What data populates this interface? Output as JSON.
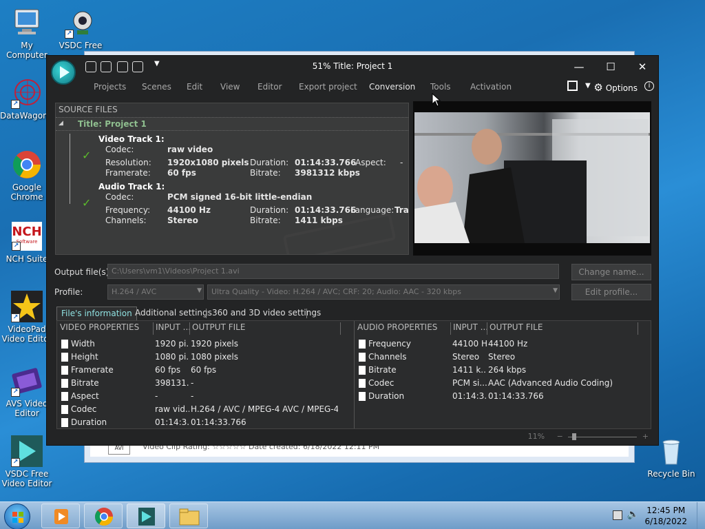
{
  "desktop": {
    "icons": [
      {
        "label": "My Computer"
      },
      {
        "label": "VSDC Free Video..."
      },
      {
        "label": "DataWagon..."
      },
      {
        "label": "Google Chrome"
      },
      {
        "label": "NCH Suite"
      },
      {
        "label": "VideoPad Video Editor"
      },
      {
        "label": "AVS Video Editor"
      },
      {
        "label": "VSDC Free Video Editor"
      },
      {
        "label": "Recycle Bin"
      }
    ],
    "nch_logo": "NCH",
    "nch_logo_sub": "Software"
  },
  "bg_window": {
    "file_type": "AVI",
    "strip_text": "Video Clip  Rating: ☆☆☆☆☆          Date created: 6/18/2022 12:11 PM"
  },
  "app": {
    "title": "51% Title: Project 1",
    "menu": [
      "Projects",
      "Scenes",
      "Edit",
      "View",
      "Editor",
      "Export project",
      "Conversion",
      "Tools",
      "Activation"
    ],
    "options_label": "Options",
    "source": {
      "header": "SOURCE FILES",
      "project_title": "Title: Project 1",
      "video_track": {
        "heading": "Video Track 1:",
        "codec_label": "Codec:",
        "codec": "raw video",
        "resolution_label": "Resolution:",
        "resolution": "1920x1080 pixels",
        "duration_label": "Duration:",
        "duration": "01:14:33.766",
        "aspect_label": "Aspect:",
        "aspect": "-",
        "framerate_label": "Framerate:",
        "framerate": "60 fps",
        "bitrate_label": "Bitrate:",
        "bitrate": "3981312 kbps"
      },
      "audio_track": {
        "heading": "Audio Track 1:",
        "codec_label": "Codec:",
        "codec": "PCM signed 16-bit little-endian",
        "frequency_label": "Frequency:",
        "frequency": "44100 Hz",
        "duration_label": "Duration:",
        "duration": "01:14:33.766",
        "language_label": "Language:",
        "language": "Tra",
        "channels_label": "Channels:",
        "channels": "Stereo",
        "bitrate_label": "Bitrate:",
        "bitrate": "1411 kbps"
      }
    },
    "output": {
      "label": "Output file(s):",
      "path": "C:\\Users\\vm1\\Videos\\Project 1.avi",
      "change_name": "Change name..."
    },
    "profile": {
      "label": "Profile:",
      "format": "H.264 / AVC",
      "preset": "Ultra Quality - Video: H.264 / AVC; CRF: 20; Audio: AAC - 320 kbps",
      "edit_profile": "Edit profile..."
    },
    "tabs": [
      "File's information",
      "Additional settings",
      "360 and 3D video settings"
    ],
    "video_props": {
      "headers": [
        "VIDEO PROPERTIES",
        "INPUT ...",
        "OUTPUT FILE"
      ],
      "rows": [
        {
          "name": "Width",
          "input": "1920 pi...",
          "output": "1920 pixels"
        },
        {
          "name": "Height",
          "input": "1080 pi...",
          "output": "1080 pixels"
        },
        {
          "name": "Framerate",
          "input": "60 fps",
          "output": "60 fps"
        },
        {
          "name": "Bitrate",
          "input": "398131...",
          "output": "-"
        },
        {
          "name": "Aspect",
          "input": "-",
          "output": "-"
        },
        {
          "name": "Codec",
          "input": "raw vid...",
          "output": "H.264 / AVC / MPEG-4 AVC / MPEG-4 ..."
        },
        {
          "name": "Duration",
          "input": "01:14:3...",
          "output": "01:14:33.766"
        }
      ]
    },
    "audio_props": {
      "headers": [
        "AUDIO PROPERTIES",
        "INPUT ...",
        "OUTPUT FILE"
      ],
      "rows": [
        {
          "name": "Frequency",
          "input": "44100 Hz",
          "output": "44100 Hz"
        },
        {
          "name": "Channels",
          "input": "Stereo",
          "output": "Stereo"
        },
        {
          "name": "Bitrate",
          "input": "1411 k...",
          "output": "264 kbps"
        },
        {
          "name": "Codec",
          "input": "PCM si...",
          "output": "AAC (Advanced Audio Coding)"
        },
        {
          "name": "Duration",
          "input": "01:14:3...",
          "output": "01:14:33.766"
        }
      ]
    },
    "zoom": "11%"
  },
  "taskbar": {
    "time": "12:45 PM",
    "date": "6/18/2022"
  }
}
